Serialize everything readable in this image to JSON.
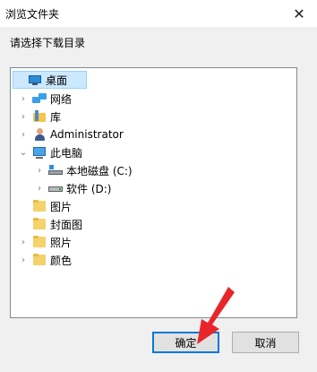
{
  "window": {
    "title": "浏览文件夹",
    "close_glyph": "✕"
  },
  "prompt": "请选择下载目录",
  "tree": {
    "items": [
      {
        "label": "桌面",
        "icon": "desktop-icon",
        "expander": "none",
        "selected": true
      },
      {
        "label": "网络",
        "icon": "network-icon",
        "expander": "collapsed"
      },
      {
        "label": "库",
        "icon": "library-icon",
        "expander": "collapsed"
      },
      {
        "label": "Administrator",
        "icon": "user-icon",
        "expander": "collapsed"
      },
      {
        "label": "此电脑",
        "icon": "pc-icon",
        "expander": "expanded"
      },
      {
        "label": "本地磁盘 (C:)",
        "icon": "drive-c-icon",
        "expander": "collapsed"
      },
      {
        "label": "软件 (D:)",
        "icon": "drive-d-icon",
        "expander": "collapsed"
      },
      {
        "label": "图片",
        "icon": "folder-icon",
        "expander": "none"
      },
      {
        "label": "封面图",
        "icon": "folder-icon",
        "expander": "none"
      },
      {
        "label": "照片",
        "icon": "folder-icon",
        "expander": "collapsed"
      },
      {
        "label": "颜色",
        "icon": "folder-icon",
        "expander": "collapsed"
      }
    ]
  },
  "buttons": {
    "ok_label": "确定",
    "cancel_label": "取消"
  },
  "colors": {
    "selection": "#cce8ff",
    "accent": "#0078d7",
    "pointer": "#e8262a"
  }
}
